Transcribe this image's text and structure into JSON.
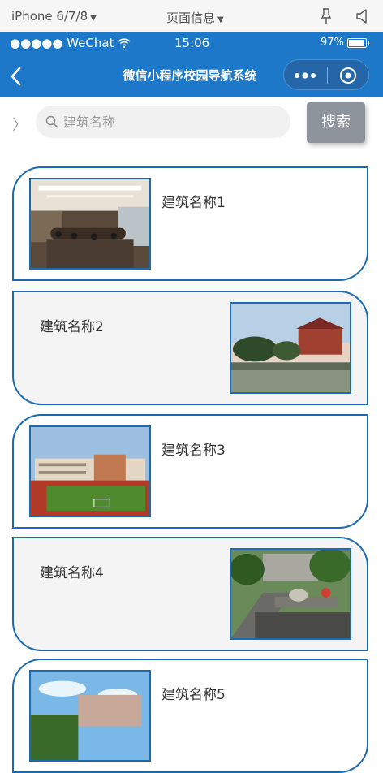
{
  "devtools": {
    "device_label": "iPhone 6/7/8",
    "page_info_label": "页面信息"
  },
  "status_bar": {
    "carrier": "●●●●● WeChat",
    "time": "15:06",
    "battery_percent": "97%",
    "battery_level": 0.97
  },
  "navbar": {
    "title": "微信小程序校园导航系统"
  },
  "search": {
    "placeholder": "建筑名称",
    "value": "",
    "button_label": "搜索"
  },
  "buildings": [
    {
      "name": "建筑名称1",
      "image": "conference-room-photo"
    },
    {
      "name": "建筑名称2",
      "image": "lake-campus-building-photo"
    },
    {
      "name": "建筑名称3",
      "image": "sports-field-building-photo"
    },
    {
      "name": "建筑名称4",
      "image": "garden-plaza-photo"
    },
    {
      "name": "建筑名称5",
      "image": "campus-sky-photo"
    }
  ],
  "colors": {
    "primary": "#1d78c9",
    "card_border": "#1c6bb0",
    "search_button": "#8e949b"
  }
}
